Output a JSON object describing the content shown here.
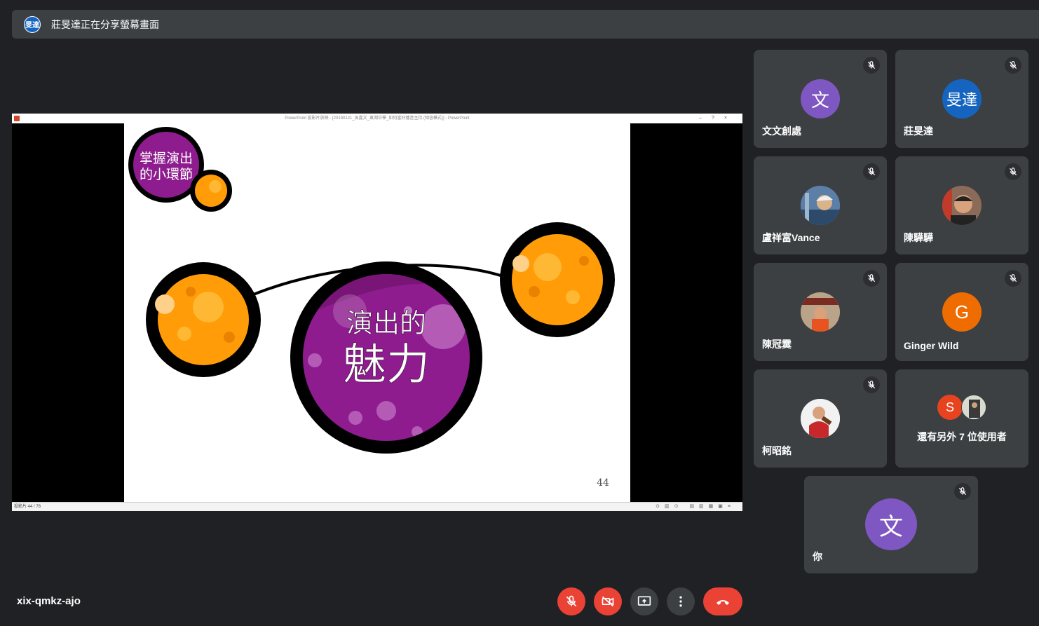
{
  "banner": {
    "presenter_avatar": "旻達",
    "text": "莊旻達正在分享螢幕畫面"
  },
  "screen": {
    "window_title": "PowerPoint 投影片放映 - [20190121_吳嘉文_東湖中學_如何當好播音主持 (相容模式)] - PowerPoint",
    "slide": {
      "badge_line1": "掌握演出",
      "badge_line2": "的小環節",
      "title_line1": "演出的",
      "title_line2": "魅力",
      "page_number": "44"
    },
    "status_text": "投影片 44 / 78"
  },
  "participants": [
    {
      "name": "文文創處",
      "avatar_letter": "文",
      "avatar_color": "#7e57c2",
      "muted": true
    },
    {
      "name": "莊旻達",
      "avatar_letter": "旻達",
      "avatar_color": "#1565c0",
      "muted": true
    },
    {
      "name": "盧祥富Vance",
      "avatar_letter": "",
      "avatar_color": "#5b7fa6",
      "muted": true
    },
    {
      "name": "陳驊驊",
      "avatar_letter": "",
      "avatar_color": "#7a5a4a",
      "muted": true
    },
    {
      "name": "陳冠霙",
      "avatar_letter": "",
      "avatar_color": "#c25a36",
      "muted": true
    },
    {
      "name": "Ginger Wild",
      "avatar_letter": "G",
      "avatar_color": "#ef6c00",
      "muted": true
    },
    {
      "name": "柯昭銘",
      "avatar_letter": "",
      "avatar_color": "#e9e9e9",
      "muted": true
    }
  ],
  "others": {
    "avatar_letter": "S",
    "text": "還有另外 7 位使用者"
  },
  "self": {
    "name": "你",
    "avatar_letter": "文",
    "avatar_color": "#7e57c2",
    "muted": true
  },
  "bottom": {
    "meeting_code": "xix-qmkz-ajo"
  },
  "icons": {
    "mic_off": "mic-off-icon",
    "camera_off": "camera-off-icon",
    "present": "present-screen-icon",
    "more": "more-vert-icon",
    "hangup": "hang-up-icon"
  },
  "colors": {
    "background": "#202124",
    "tile": "#3c4043",
    "danger": "#ea4335"
  }
}
